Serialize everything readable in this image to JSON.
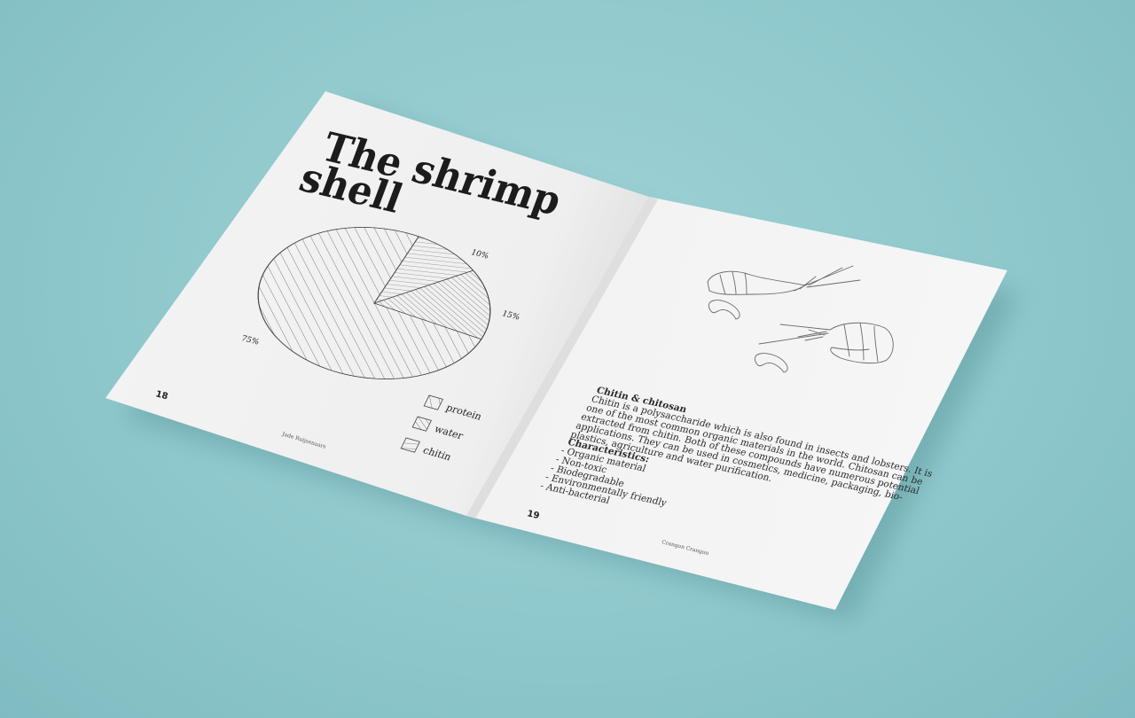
{
  "left_page": {
    "title_line1": "The shrimp",
    "title_line2": "shell",
    "page_number": "18",
    "footer": "Jade Ruijsenaars"
  },
  "chart_data": {
    "type": "pie",
    "slices": [
      {
        "label": "protein",
        "value": 75,
        "value_label": "75%",
        "pattern": "wide-diagonal"
      },
      {
        "label": "water",
        "value": 15,
        "value_label": "15%",
        "pattern": "tight-diagonal"
      },
      {
        "label": "chitin",
        "value": 10,
        "value_label": "10%",
        "pattern": "horizontal"
      }
    ],
    "legend_placement": "bottom-right"
  },
  "right_page": {
    "page_number": "19",
    "footer": "Crangon Crangon",
    "heading": "Chitin & chitosan",
    "body_lines": [
      "Chitin is a polysaccharide which is also found in insects and lobsters. It is",
      "one of the most common organic materials in the world. Chitosan can be",
      "extracted from chitin. Both of these compounds have numerous potential",
      "applications. They can be used in cosmetics, medicine, packaging, bio-",
      "plastics, agriculture and water purification."
    ],
    "characteristics_heading": "Characteristics:",
    "characteristics": [
      "- Organic material",
      "- Non-toxic",
      "- Biodegradable",
      "- Environmentally friendly",
      "- Anti-bacterial"
    ]
  },
  "colors": {
    "background": "#8fc8cc",
    "paper": "#f3f3f3",
    "ink": "#1c1c1c"
  }
}
